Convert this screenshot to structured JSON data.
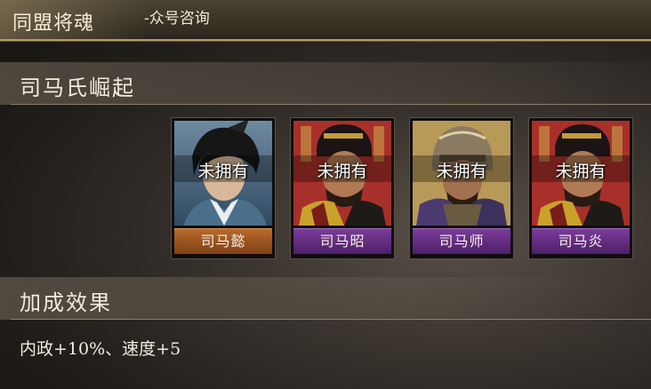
{
  "header": {
    "title": "同盟将魂",
    "subtitle": "-众号咨询"
  },
  "set": {
    "title": "司马氏崛起",
    "cards": [
      {
        "name": "司马懿",
        "status": "未拥有",
        "rarity_color": "#b86a2a"
      },
      {
        "name": "司马昭",
        "status": "未拥有",
        "rarity_color": "#7a3c9a"
      },
      {
        "name": "司马师",
        "status": "未拥有",
        "rarity_color": "#7a3c9a"
      },
      {
        "name": "司马炎",
        "status": "未拥有",
        "rarity_color": "#7a3c9a"
      }
    ]
  },
  "bonus": {
    "title": "加成效果",
    "text": "内政+10%、速度+5"
  }
}
